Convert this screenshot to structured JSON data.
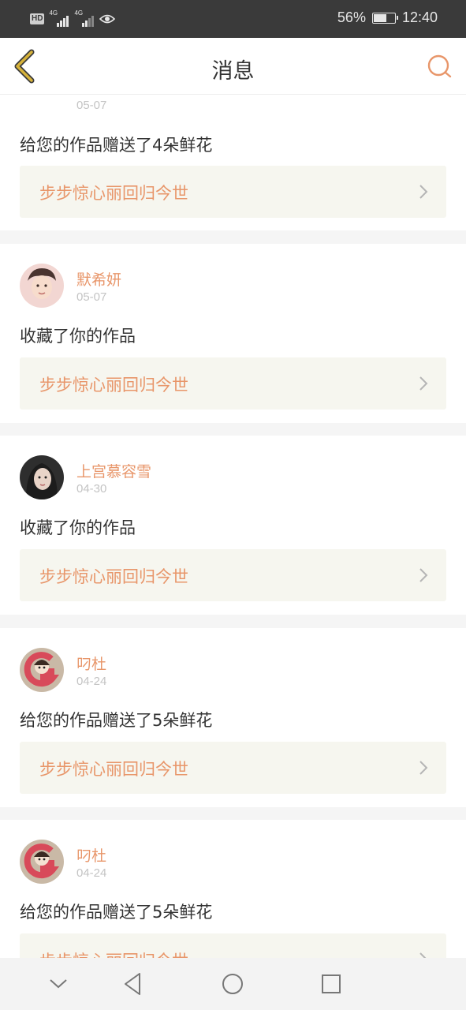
{
  "status_bar": {
    "hd": "HD",
    "network1": "4G",
    "network2": "4G",
    "battery_pct": "56%",
    "battery_level": 0.56,
    "time": "12:40"
  },
  "header": {
    "title": "消息"
  },
  "colors": {
    "accent": "#e8966a",
    "back_icon": "#d6b23a",
    "card_link_bg": "#f6f6ef"
  },
  "messages": [
    {
      "username": "",
      "date": "05-07",
      "action": "给您的作品赠送了4朵鲜花",
      "work_title": "步步惊心丽回归今世"
    },
    {
      "username": "默希妍",
      "date": "05-07",
      "action": "收藏了你的作品",
      "work_title": "步步惊心丽回归今世"
    },
    {
      "username": "上宫慕容雪",
      "date": "04-30",
      "action": "收藏了你的作品",
      "work_title": "步步惊心丽回归今世"
    },
    {
      "username": "叼杜",
      "date": "04-24",
      "action": "给您的作品赠送了5朵鲜花",
      "work_title": "步步惊心丽回归今世"
    },
    {
      "username": "叼杜",
      "date": "04-24",
      "action": "给您的作品赠送了5朵鲜花",
      "work_title": "步步惊心丽回归今世"
    }
  ],
  "icons": {
    "back": "back-chevron-icon",
    "search": "search-icon",
    "link_chevron": "chevron-right-icon",
    "sys_down": "chevron-down-icon",
    "sys_back": "triangle-back-icon",
    "sys_home": "circle-home-icon",
    "sys_recent": "square-recent-icon"
  }
}
